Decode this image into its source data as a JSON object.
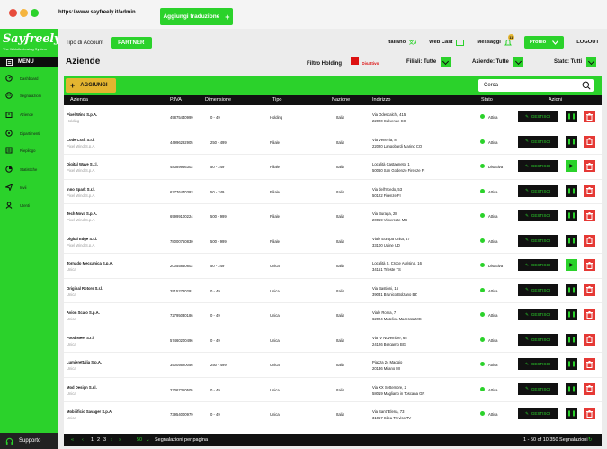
{
  "browser": {
    "url": "https://www.sayfreely.it/admin",
    "add_translation": "Aggiungi traduzione"
  },
  "sidebar": {
    "logo": "Sayfreely",
    "tagline": "The Whistleblowing System",
    "menu": "MENU",
    "items": [
      {
        "label": "Dashboard",
        "icon": "dashboard-icon"
      },
      {
        "label": "Segnalazioni",
        "icon": "chat-icon"
      },
      {
        "label": "Aziende",
        "icon": "building-icon"
      },
      {
        "label": "Dipartimenti",
        "icon": "department-icon"
      },
      {
        "label": "Riepilogo",
        "icon": "summary-icon"
      },
      {
        "label": "Statistiche",
        "icon": "pie-chart-icon"
      },
      {
        "label": "Invii",
        "icon": "send-icon"
      },
      {
        "label": "Utenti",
        "icon": "user-icon"
      }
    ],
    "support": "Supporto"
  },
  "topbar": {
    "account_label": "Tipo di Account",
    "account_type": "PARTNER",
    "language": "Italiano",
    "webcast": "Web Cast",
    "messages": "Messaggi",
    "messages_count": "11",
    "profile": "Profilo",
    "logout": "LOGOUT"
  },
  "filters": {
    "title": "Aziende",
    "holding": "Filtro Holding",
    "holding_state": "Disattivo",
    "subsidiaries": "Filiali: Tutte",
    "companies": "Aziende: Tutte",
    "state": "Stato: Tutti"
  },
  "table": {
    "add_label": "AGGIUNGI",
    "search_placeholder": "Cerca",
    "columns": [
      "Azienda",
      "P.IVA",
      "Dimensione",
      "Tipo",
      "Nazione",
      "Indirizzo",
      "Stato",
      "Azioni"
    ],
    "manage_label": "GESTISCI",
    "rows": [
      {
        "name": "Pixel Wind S.p.A.",
        "tipo2": "Holding",
        "piva": "49875440999",
        "dim": "0 - 49",
        "tipo": "Holding",
        "naz": "Italia",
        "ind1": "Via Odescalchi, 415",
        "ind2": "22020 Calvende CO",
        "stato": "Attiva",
        "play": false
      },
      {
        "name": "Code Craft S.r.l.",
        "tipo2": "Pixel Wind S.p.A.",
        "piva": "44996292905",
        "dim": "250 - 499",
        "tipo": "Filiale",
        "naz": "Italia",
        "ind1": "Via Venezia, 8",
        "ind2": "22020 Langobardi Marino CO",
        "stato": "Attiva",
        "play": false
      },
      {
        "name": "Digital Wave S.r.l.",
        "tipo2": "Pixel Wind S.p.A.",
        "piva": "48389966302",
        "dim": "50 - 249",
        "tipo": "Filiale",
        "naz": "Italia",
        "ind1": "Località Castagneto, 1",
        "ind2": "50060 San Godenzo Firenze FI",
        "stato": "Disattiva",
        "play": true
      },
      {
        "name": "Inno Spark S.r.l.",
        "tipo2": "Pixel Wind S.p.A.",
        "piva": "62776470393",
        "dim": "50 - 249",
        "tipo": "Filiale",
        "naz": "Italia",
        "ind1": "Via dell'Ircedo, 53",
        "ind2": "50122 Firenze FI",
        "stato": "Attiva",
        "play": false
      },
      {
        "name": "Tech Nova S.p.A.",
        "tipo2": "Pixel Wind S.p.A.",
        "piva": "69999100224",
        "dim": "500 - 999",
        "tipo": "Filiale",
        "naz": "Italia",
        "ind1": "Via Buraga, 28",
        "ind2": "20059 Vimercate MB",
        "stato": "Attiva",
        "play": false
      },
      {
        "name": "Digital Edge S.r.l.",
        "tipo2": "Pixel Wind S.p.A.",
        "piva": "78000750830",
        "dim": "500 - 999",
        "tipo": "Filiale",
        "naz": "Italia",
        "ind1": "Viale Europa Unita, 47",
        "ind2": "33100 Udine UD",
        "stato": "Attiva",
        "play": false
      },
      {
        "name": "Tornado Meccanica S.p.A.",
        "tipo2": "Unica",
        "piva": "20055850802",
        "dim": "50 - 249",
        "tipo": "Unica",
        "naz": "Italia",
        "ind1": "Località S. Croce Aurisina, 16",
        "ind2": "34151 Trieste TS",
        "stato": "Disattiva",
        "play": true
      },
      {
        "name": "Original Rotors S.r.l.",
        "tipo2": "Unica",
        "piva": "29152780291",
        "dim": "0 - 49",
        "tipo": "Unica",
        "naz": "Italia",
        "ind1": "Via Bastioni, 16",
        "ind2": "39031 Brunico Bolzano BZ",
        "stato": "Attiva",
        "play": false
      },
      {
        "name": "Avion Scalo S.p.A.",
        "tipo2": "Unica",
        "piva": "72795030186",
        "dim": "0 - 49",
        "tipo": "Unica",
        "naz": "Italia",
        "ind1": "Viale Roma, 7",
        "ind2": "62024 Matelica Macerata MC",
        "stato": "Attiva",
        "play": false
      },
      {
        "name": "Food Meet S.r.l.",
        "tipo2": "Unica",
        "piva": "57460200496",
        "dim": "0 - 49",
        "tipo": "Unica",
        "naz": "Italia",
        "ind1": "Via IV Novembre, 65",
        "ind2": "24126 Bergamo BG",
        "stato": "Attiva",
        "play": false
      },
      {
        "name": "Lumierettalia S.p.A.",
        "tipo2": "Unica",
        "piva": "35005620056",
        "dim": "250 - 499",
        "tipo": "Unica",
        "naz": "Italia",
        "ind1": "Piazza 24 Maggio",
        "ind2": "20136 Milano MI",
        "stato": "Attiva",
        "play": false
      },
      {
        "name": "Mod Design S.r.l.",
        "tipo2": "Unica",
        "piva": "23067350505",
        "dim": "0 - 49",
        "tipo": "Unica",
        "naz": "Italia",
        "ind1": "Via XX Settembre, 2",
        "ind2": "58019 Magliano in Toscana GR",
        "stato": "Attiva",
        "play": false
      },
      {
        "name": "Mobilificio Savager S.p.A.",
        "tipo2": "Unica",
        "piva": "73954000979",
        "dim": "0 - 49",
        "tipo": "Unica",
        "naz": "Italia",
        "ind1": "Via Sant' Elena, 73",
        "ind2": "31057 Silea Treviso TV",
        "stato": "Attiva",
        "play": false
      }
    ]
  },
  "footer": {
    "pages": [
      "1",
      "2",
      "3"
    ],
    "per_page": "50",
    "per_page_label": "Segnalazioni per pagina",
    "range": "1 - 50 of 10.350 Segnalazioni"
  },
  "colors": {
    "accent": "#2bd22b",
    "dark": "#111111",
    "danger": "#e53935",
    "warning": "#e3b530"
  }
}
